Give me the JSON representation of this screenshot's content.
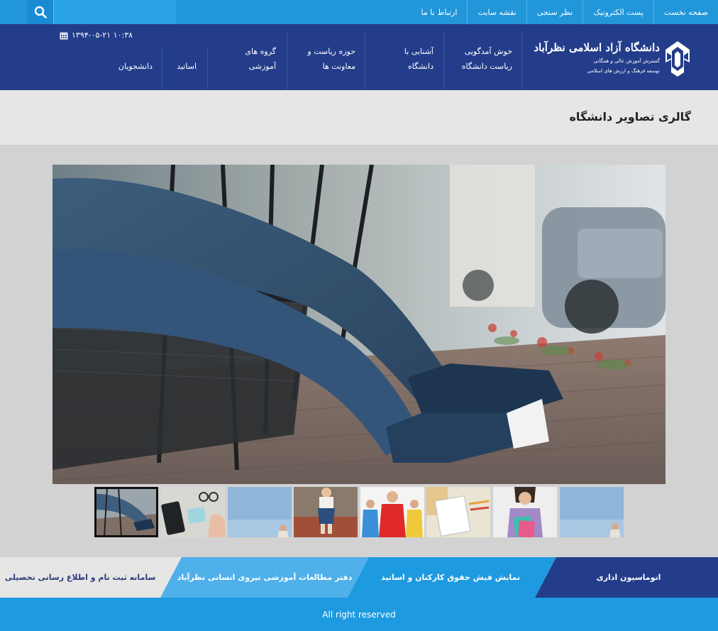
{
  "search": {
    "placeholder": ""
  },
  "top_nav": {
    "items": [
      {
        "label": "صفحه نخست"
      },
      {
        "label": "پست الکترونیک"
      },
      {
        "label": "نظر سنجی"
      },
      {
        "label": "نقشه سایت"
      },
      {
        "label": "ارتباط با ما"
      }
    ]
  },
  "logo": {
    "title": "دانشگاه آزاد اسلامی نظرآباد",
    "subtitle_line1": "گسترش آموزش عالی و همگانی",
    "subtitle_line2": "توسعه فرهنگ و ارزش های اسلامی"
  },
  "main_nav": {
    "items": [
      {
        "line1": "خوش آمدگویی",
        "line2": "ریاست دانشگاه"
      },
      {
        "line1": "آشنایی با",
        "line2": "دانشگاه"
      },
      {
        "line1": "حوزه ریاست و",
        "line2": "معاونت ها"
      },
      {
        "line1": "گروه های",
        "line2": "آموزشی"
      },
      {
        "line1": "اساتید",
        "line2": ""
      },
      {
        "line1": "دانشجویان",
        "line2": ""
      }
    ]
  },
  "datetime": {
    "text": "۱۳۹۴-۰۵-۲۱ ۱۰:۳۸"
  },
  "page": {
    "title": "گالری تصاویر دانشگاه"
  },
  "gallery": {
    "main_image": "jeans-sneakers-cafe-chair-photo",
    "thumbnails": [
      {
        "subject": "jeans-sneakers-photo",
        "active": true
      },
      {
        "subject": "desk-phone-glasses-photo",
        "active": false
      },
      {
        "subject": "sky-person-photo",
        "active": false
      },
      {
        "subject": "sitting-person-photo",
        "active": false
      },
      {
        "subject": "students-group-photo",
        "active": false
      },
      {
        "subject": "notebook-pencils-photo",
        "active": false
      },
      {
        "subject": "student-holding-books-photo",
        "active": false
      },
      {
        "subject": "sky-person-photo",
        "active": false
      }
    ]
  },
  "banners": {
    "items": [
      {
        "label": "اتوماسیون اداری"
      },
      {
        "label": "نمایش فیش حقوق کارکنان و اساتید"
      },
      {
        "label": "دفتر مطالعات آموزشی نیروی انسانی نظرآباد"
      },
      {
        "label": "سامانه ثبت نام و اطلاع رسانی تحصیلی"
      }
    ]
  },
  "footer": {
    "text": "All right reserved"
  },
  "colors": {
    "topbar": "#2196d9",
    "header": "#233d8a",
    "footer": "#1e9ae0",
    "banner_dark": "#233d8a",
    "banner_blue": "#1e9ae0",
    "banner_light": "#4fb0ea",
    "banner_gray": "#e6e6e6"
  }
}
